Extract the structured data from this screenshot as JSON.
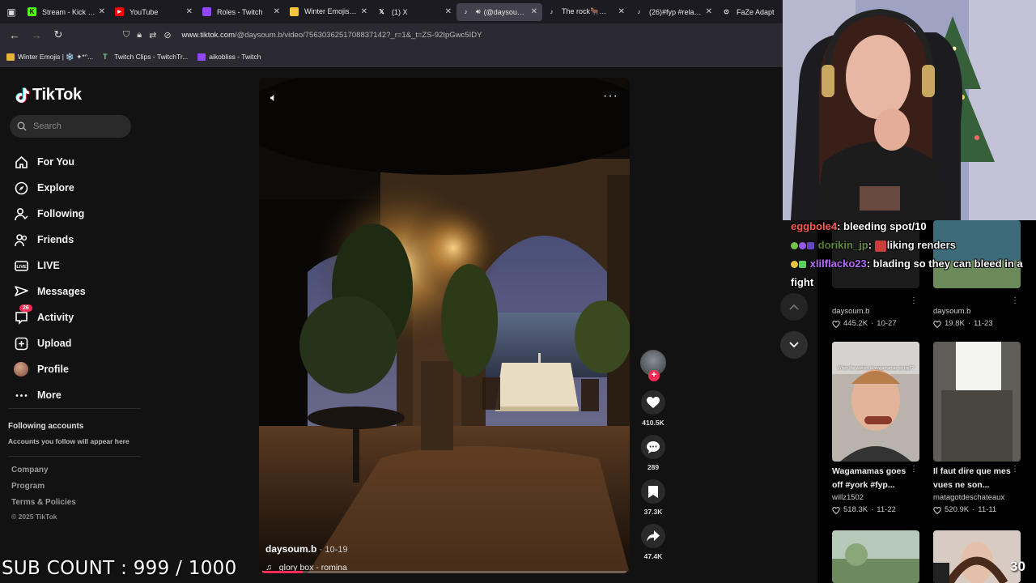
{
  "browser": {
    "tabs": [
      {
        "label": "Stream - Kick Dashb",
        "icon": "kick-icon",
        "color": "#53fc18",
        "active": false
      },
      {
        "label": "YouTube",
        "icon": "youtube-icon",
        "color": "#ff0000",
        "active": false
      },
      {
        "label": "Roles - Twitch",
        "icon": "twitch-icon",
        "color": "#9146ff",
        "active": false
      },
      {
        "label": "Winter Emojis | ❄️ ✦",
        "icon": "folder-icon",
        "color": "#f5c542",
        "active": false
      },
      {
        "label": "(1) X",
        "icon": "x-icon",
        "color": "#ffffff",
        "active": false
      },
      {
        "label": "(@daysoum.b)",
        "icon": "tiktok-icon",
        "color": "#ffffff",
        "active": true
      },
      {
        "label": "The rock🐂😂 #ww",
        "icon": "tiktok-icon",
        "color": "#ffffff",
        "active": false
      },
      {
        "label": "(26)#fyp #relatable",
        "icon": "tiktok-icon",
        "color": "#ffffff",
        "active": false
      },
      {
        "label": "FaZe Adapt",
        "icon": "play-icon",
        "color": "#ffffff",
        "active": false
      }
    ],
    "url_host": "www.tiktok.com",
    "url_path": "/@daysoum.b/video/7563036251708837142?_r=1&_t=ZS-92IpGwc5IDY",
    "bookmarks": [
      {
        "label": "Winter Emojis | ❄️ ✦*ᐢ...",
        "icon": "folder-icon"
      },
      {
        "label": "Twitch Clips - TwitchTr...",
        "icon": "twitchtracker-icon"
      },
      {
        "label": "aikobliss - Twitch",
        "icon": "twitch-icon"
      }
    ]
  },
  "tiktok": {
    "brand": "TikTok",
    "search_placeholder": "Search",
    "nav": [
      {
        "label": "For You",
        "icon": "home-icon"
      },
      {
        "label": "Explore",
        "icon": "compass-icon"
      },
      {
        "label": "Following",
        "icon": "following-icon"
      },
      {
        "label": "Friends",
        "icon": "friends-icon"
      },
      {
        "label": "LIVE",
        "icon": "live-icon"
      },
      {
        "label": "Messages",
        "icon": "messages-icon"
      },
      {
        "label": "Activity",
        "icon": "activity-icon",
        "badge": "26"
      },
      {
        "label": "Upload",
        "icon": "upload-icon"
      },
      {
        "label": "Profile",
        "icon": "avatar"
      },
      {
        "label": "More",
        "icon": "more-icon"
      }
    ],
    "following_title": "Following accounts",
    "following_sub": "Accounts you follow will appear here",
    "footer": [
      "Company",
      "Program",
      "Terms & Policies"
    ],
    "copyright": "© 2025 TikTok",
    "video": {
      "author": "daysoum.b",
      "date": "· 10-19",
      "music": "glory box - romina",
      "progress": 0.11,
      "likes": "410.5K",
      "comments": "289",
      "saves": "37.3K",
      "shares": "47.4K"
    },
    "grid": [
      {
        "title": "",
        "user": "daysoum.b",
        "likes": "445.2K",
        "date": "10-27",
        "thumb": "top-a"
      },
      {
        "title": "",
        "user": "daysoum.b",
        "likes": "19.8K",
        "date": "11-23",
        "thumb": "top-b"
      },
      {
        "title": "Wagamamas goes off #york #fyp...",
        "user": "willz1502",
        "likes": "518.3K",
        "date": "11-22",
        "thumb": "selfie",
        "overlay_text": "When the waiters at wagamamas so big??"
      },
      {
        "title": "Il faut dire que mes vues ne son...",
        "user": "matagotdeschateaux",
        "likes": "520.9K",
        "date": "11-11",
        "thumb": "window"
      },
      {
        "title": "",
        "user": "",
        "likes": "",
        "date": "",
        "thumb": "garden"
      },
      {
        "title": "",
        "user": "",
        "likes": "",
        "date": "",
        "thumb": "girl"
      }
    ]
  },
  "stream": {
    "chat": [
      {
        "user": "eggbole4",
        "msg": ": bleeding spot/10"
      },
      {
        "user": "dorikin_jp",
        "msg": ": ",
        "msg2": "liking renders"
      },
      {
        "user": "xlilflacko23",
        "msg": ": blading so they can bleed in a fight"
      }
    ],
    "sub_count": "SUB COUNT : 999 / 1000",
    "corner_number": "30"
  }
}
